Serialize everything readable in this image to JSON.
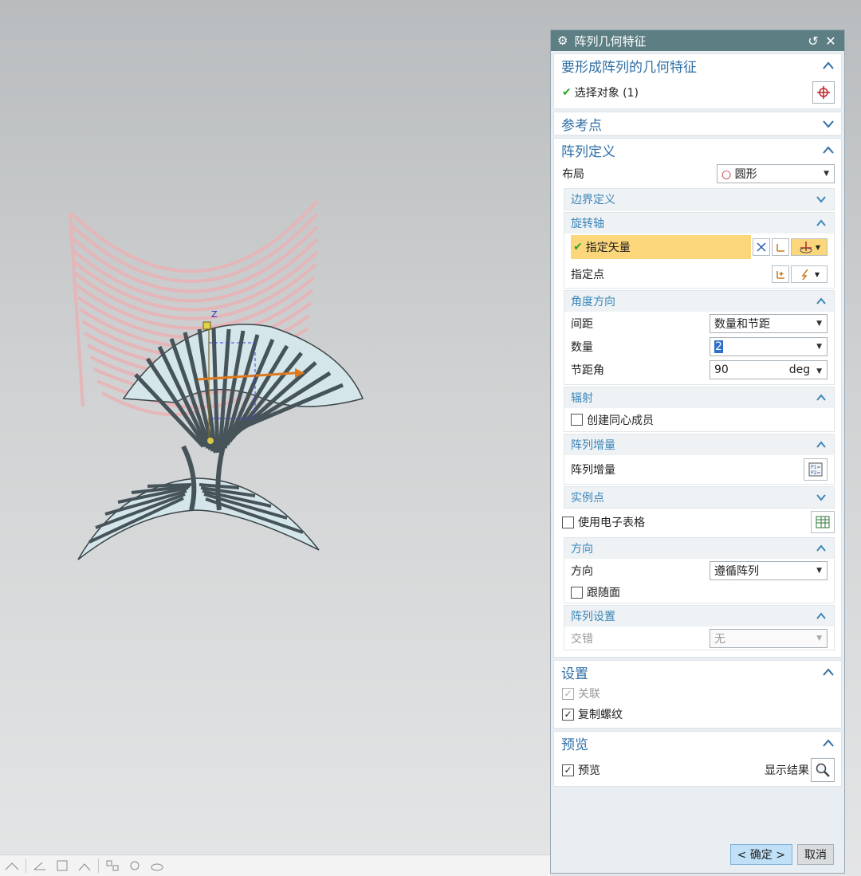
{
  "dialog": {
    "title": "阵列几何特征",
    "sections": {
      "features": {
        "header": "要形成阵列的几何特征",
        "select_label": "选择对象 (1)"
      },
      "reference": {
        "header": "参考点"
      },
      "pattern_def": {
        "header": "阵列定义",
        "layout_label": "布局",
        "layout_value": "圆形",
        "boundary_header": "边界定义",
        "rotation_axis": {
          "header": "旋转轴",
          "vector_label": "指定矢量",
          "point_label": "指定点"
        },
        "angle_direction": {
          "header": "角度方向",
          "spacing_label": "间距",
          "spacing_value": "数量和节距",
          "count_label": "数量",
          "count_value": "2",
          "pitch_label": "节距角",
          "pitch_value": "90",
          "pitch_unit": "deg"
        },
        "radiation": {
          "header": "辐射",
          "concentric_label": "创建同心成员"
        },
        "increment": {
          "header": "阵列增量",
          "label": "阵列增量"
        },
        "instance": {
          "header": "实例点",
          "spreadsheet_label": "使用电子表格"
        },
        "orientation": {
          "header": "方向",
          "label": "方向",
          "value": "遵循阵列",
          "follow_face_label": "跟随面"
        },
        "settings": {
          "header": "阵列设置",
          "stagger_label": "交错",
          "stagger_value": "无"
        }
      },
      "settings": {
        "header": "设置",
        "associative_label": "关联",
        "copy_threads_label": "复制螺纹"
      },
      "preview": {
        "header": "预览",
        "preview_label": "预览",
        "show_result_label": "显示结果"
      }
    },
    "buttons": {
      "ok": "< 确定 >",
      "cancel": "取消"
    }
  },
  "colors": {
    "title_bar": "#5d7f84",
    "section_header": "#2f6fa5",
    "highlight": "#fcd67a",
    "ok_button": "#bfe0f7"
  }
}
